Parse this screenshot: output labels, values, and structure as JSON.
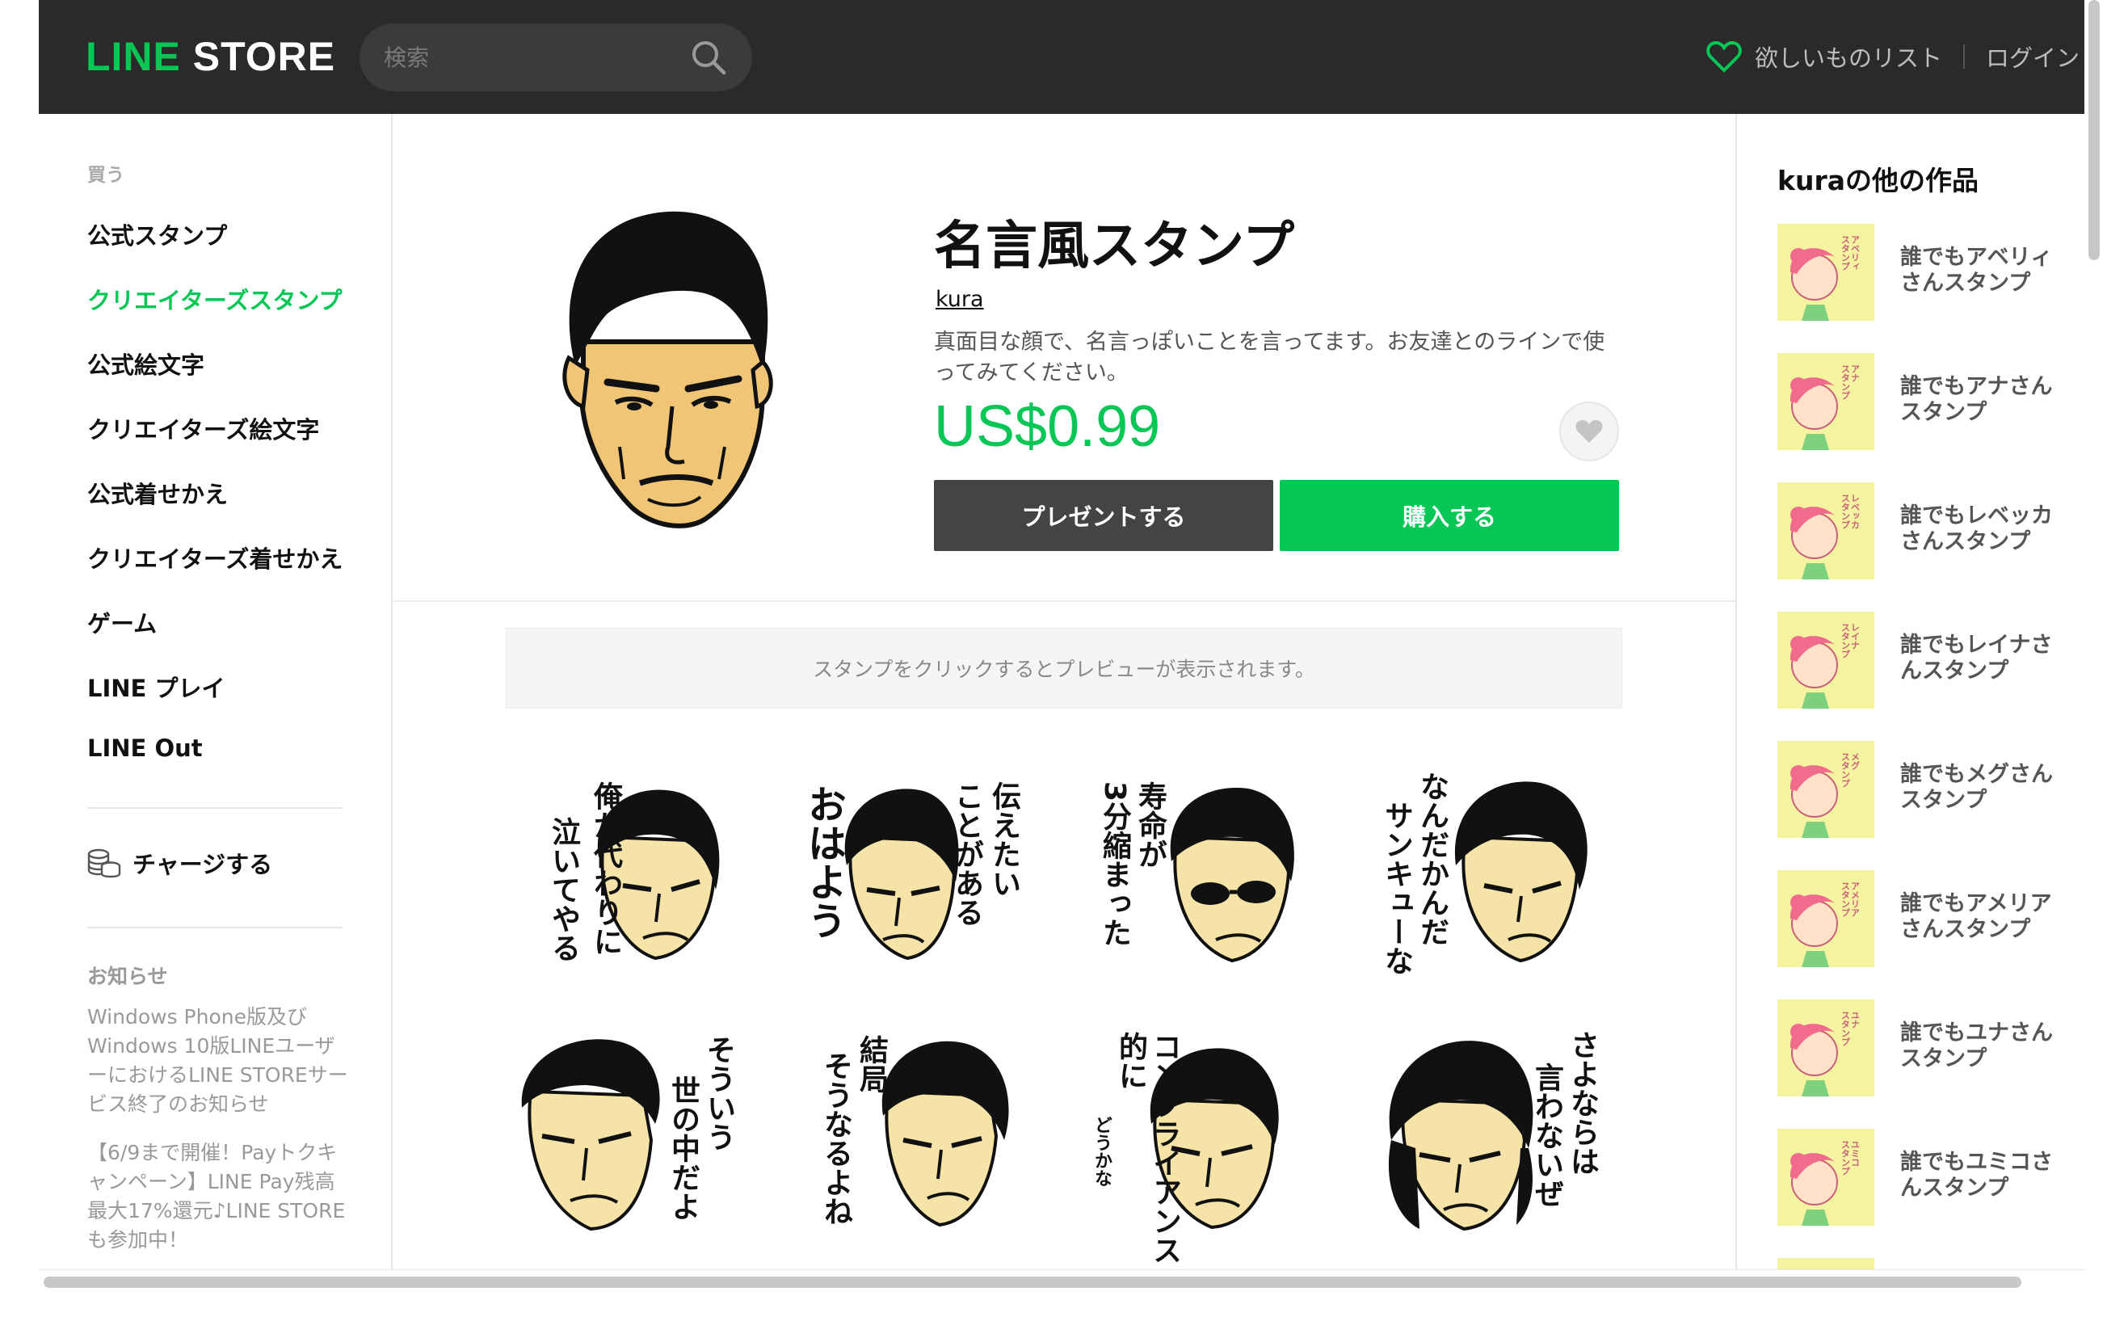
{
  "header": {
    "logo_line": "LINE",
    "logo_store": " STORE",
    "search_placeholder": "検索",
    "wishlist_label": "欲しいものリスト",
    "login_label": "ログイン"
  },
  "sidebar": {
    "heading": "買う",
    "items": [
      {
        "label": "公式スタンプ"
      },
      {
        "label": "クリエイターズスタンプ"
      },
      {
        "label": "公式絵文字"
      },
      {
        "label": "クリエイターズ絵文字"
      },
      {
        "label": "公式着せかえ"
      },
      {
        "label": "クリエイターズ着せかえ"
      },
      {
        "label": "ゲーム"
      },
      {
        "label": "LINE プレイ"
      },
      {
        "label": "LINE Out"
      }
    ],
    "active_item": "クリエイターズスタンプ",
    "charge_label": "チャージする",
    "news_heading": "お知らせ",
    "news": [
      "Windows Phone版及びWindows 10版LINEユーザーにおけるLINE STOREサービス終了のお知らせ",
      "【6/9まで開催！Payトクキャンペーン】LINE Pay残高最大17%還元♪LINE STOREも参加中！"
    ]
  },
  "product": {
    "title": "名言風スタンプ",
    "author": "kura",
    "description": "真面目な顔で、名言っぽいことを言ってます。お友達とのラインで使ってみてください。",
    "price": "US$0.99",
    "gift_label": "プレゼントする",
    "buy_label": "購入する",
    "preview_note": "スタンプをクリックするとプレビューが表示されます。",
    "stickers": [
      {
        "caption_lines": [
          "俺が代わりに",
          "泣いてやる"
        ]
      },
      {
        "caption_lines": [
          "伝えたい",
          "ことがある",
          "おはよう"
        ]
      },
      {
        "caption_lines": [
          "寿命が",
          "3分縮まった"
        ]
      },
      {
        "caption_lines": [
          "なんだかんだ",
          "サンキューな"
        ]
      },
      {
        "caption_lines": [
          "そういう",
          "世の中だよ"
        ]
      },
      {
        "caption_lines": [
          "結局",
          "そうなるよね"
        ]
      },
      {
        "caption_lines": [
          "コンプライアンス的に",
          "どうかな"
        ]
      },
      {
        "caption_lines": [
          "さよならは",
          "言わないぜ"
        ]
      }
    ]
  },
  "other_works": {
    "heading": "kuraの他の作品",
    "items": [
      {
        "name": "誰でもアベリィさんスタンプ",
        "thumb_text": "アベリィスタンプ"
      },
      {
        "name": "誰でもアナさんスタンプ",
        "thumb_text": "アナスタンプ"
      },
      {
        "name": "誰でもレベッカさんスタンプ",
        "thumb_text": "レベッカスタンプ"
      },
      {
        "name": "誰でもレイナさんスタンプ",
        "thumb_text": "レイナスタンプ"
      },
      {
        "name": "誰でもメグさんスタンプ",
        "thumb_text": "メグスタンプ"
      },
      {
        "name": "誰でもアメリアさんスタンプ",
        "thumb_text": "アメリアスタンプ"
      },
      {
        "name": "誰でもユナさんスタンプ",
        "thumb_text": "ユナスタンプ"
      },
      {
        "name": "誰でもユミコさんスタンプ",
        "thumb_text": "ユミコスタンプ"
      }
    ]
  },
  "colors": {
    "brand_green": "#06c755",
    "header_bg": "#2a2a2a",
    "gift_button": "#444444"
  },
  "icons": {
    "search": "search-icon",
    "wishlist": "heart-icon",
    "favorite": "heart-icon",
    "charge": "coins-icon"
  }
}
